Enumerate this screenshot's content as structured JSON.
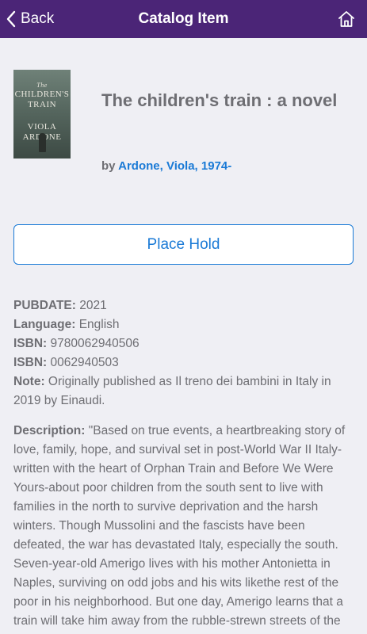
{
  "nav": {
    "back_label": "Back",
    "title": "Catalog Item",
    "home_icon": "home-icon"
  },
  "cover": {
    "title_line1": "The",
    "title_line2": "CHILDREN'S",
    "title_line3": "TRAIN",
    "author_line1": "VIOLA",
    "author_line2": "ARDONE"
  },
  "item": {
    "title": "The children's train : a novel",
    "by_label": "by",
    "author": "Ardone, Viola, 1974-"
  },
  "hold_button": "Place Hold",
  "details": {
    "pubdate_label": "PUBDATE:",
    "pubdate": "2021",
    "language_label": "Language:",
    "language": "English",
    "isbn_label": "ISBN:",
    "isbn1": "9780062940506",
    "isbn2": "0062940503",
    "note_label": "Note:",
    "note": "Originally published as Il treno dei bambini in Italy in 2019 by Einaudi."
  },
  "description": {
    "label": "Description:",
    "text": "\"Based on true events, a heartbreaking story of love, family, hope, and survival set in post-World War II Italy-written with the heart of Orphan Train and Before We Were Yours-about poor children from the south sent to live with families in the north to survive deprivation and the harsh winters. Though Mussolini and the fascists have been defeated, the war has devastated Italy, especially the south. Seven-year-old Amerigo lives with his mother Antonietta in Naples, surviving on odd jobs and his wits likethe rest of the poor in his neighborhood. But one day, Amerigo learns that a train will take him away from the rubble-strewn streets of the"
  },
  "colors": {
    "nav_bg": "#4b2577",
    "accent": "#1a7ad6",
    "text": "#6e6e73",
    "background": "#efeff4"
  }
}
